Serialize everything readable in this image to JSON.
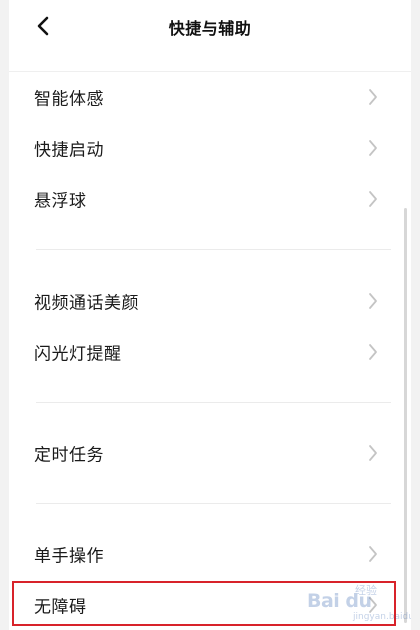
{
  "header": {
    "title": "快捷与辅助",
    "back_icon": "chevron-left-icon"
  },
  "groups": [
    {
      "items": [
        {
          "label": "智能体感",
          "icon": "chevron-right-icon"
        },
        {
          "label": "快捷启动",
          "icon": "chevron-right-icon"
        },
        {
          "label": "悬浮球",
          "icon": "chevron-right-icon"
        }
      ]
    },
    {
      "items": [
        {
          "label": "视频通话美颜",
          "icon": "chevron-right-icon"
        },
        {
          "label": "闪光灯提醒",
          "icon": "chevron-right-icon"
        }
      ]
    },
    {
      "items": [
        {
          "label": "定时任务",
          "icon": "chevron-right-icon"
        }
      ]
    },
    {
      "items": [
        {
          "label": "单手操作",
          "icon": "chevron-right-icon"
        },
        {
          "label": "无障碍",
          "icon": "chevron-right-icon",
          "highlighted": true
        }
      ]
    }
  ],
  "highlight_color": "#d8232a",
  "watermark": {
    "brand": "Bai du",
    "sub": "经验",
    "url": "jingyan.baidu.com"
  }
}
